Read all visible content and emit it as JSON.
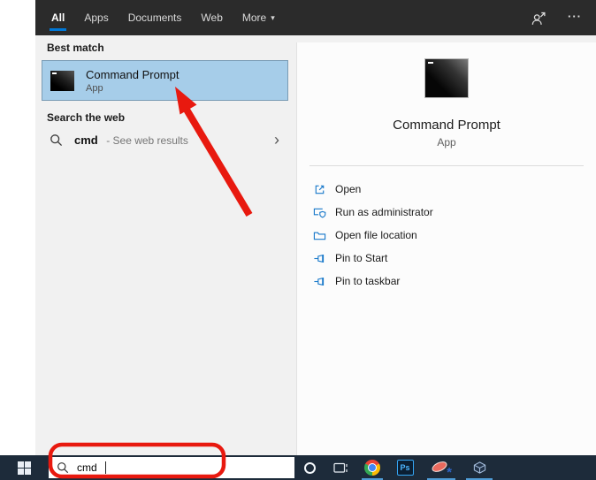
{
  "window": {
    "header": {
      "tabs": [
        {
          "label": "All",
          "active": true
        },
        {
          "label": "Apps",
          "active": false
        },
        {
          "label": "Documents",
          "active": false
        },
        {
          "label": "Web",
          "active": false
        },
        {
          "label": "More",
          "active": false
        }
      ]
    },
    "results": {
      "best_match_label": "Best match",
      "best_match_item": {
        "title": "Command Prompt",
        "subtitle": "App"
      },
      "web_label": "Search the web",
      "web_item": {
        "query": "cmd",
        "suffix": "- See web results"
      }
    },
    "preview": {
      "title": "Command Prompt",
      "subtitle": "App",
      "actions": [
        {
          "label": "Open",
          "icon": "open-icon"
        },
        {
          "label": "Run as administrator",
          "icon": "admin-shield-icon"
        },
        {
          "label": "Open file location",
          "icon": "folder-location-icon"
        },
        {
          "label": "Pin to Start",
          "icon": "pin-icon"
        },
        {
          "label": "Pin to taskbar",
          "icon": "pin-icon"
        }
      ]
    }
  },
  "taskbar": {
    "search_value": "cmd",
    "app_icons": [
      "cortana",
      "task-view",
      "chrome",
      "photoshop",
      "media-disc-app",
      "virtualbox"
    ],
    "running_apps": [
      "chrome",
      "media-disc-app",
      "virtualbox"
    ]
  },
  "glyphs": {
    "more_dropdown": "▾",
    "ellipsis": "···",
    "web_chevron": "›",
    "photoshop": "Ps",
    "media_gear": "*"
  },
  "colors": {
    "accent_blue": "#0078d7",
    "selection_fill": "#a6cde9",
    "selection_border": "#7a9cb5",
    "annotation_red": "#e8190f",
    "taskbar_bg": "#1d2b3a",
    "action_icon_blue": "#1979ca",
    "running_underline": "#4f9cd6"
  }
}
